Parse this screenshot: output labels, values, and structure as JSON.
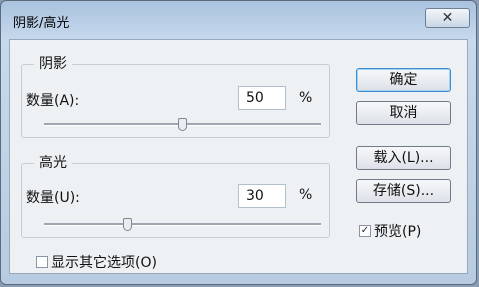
{
  "window": {
    "title": "阴影/高光",
    "close_symbol": "✕"
  },
  "shadow": {
    "group_title": "阴影",
    "amount_label": "数量(A):",
    "amount_value": "50",
    "unit": "%",
    "slider_fraction": 0.5
  },
  "highlight": {
    "group_title": "高光",
    "amount_label": "数量(U):",
    "amount_value": "30",
    "unit": "%",
    "slider_fraction": 0.3
  },
  "buttons": {
    "ok": "确定",
    "cancel": "取消",
    "load": "载入(L)...",
    "save": "存储(S)..."
  },
  "preview": {
    "label": "预览(P)",
    "checked": true,
    "check_mark": "✓"
  },
  "more_options": {
    "label": "显示其它选项(O)",
    "checked": false
  }
}
